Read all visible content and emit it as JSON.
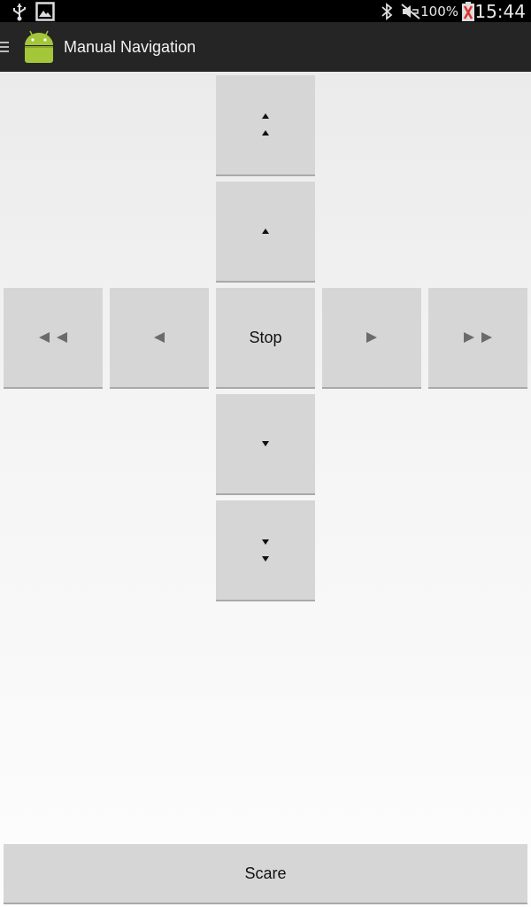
{
  "status_bar": {
    "battery_percent": "100%",
    "time": "15:44",
    "icons": [
      "usb-icon",
      "gallery-icon",
      "bluetooth-icon",
      "mute-icon",
      "battery-icon"
    ]
  },
  "action_bar": {
    "title": "Manual Navigation",
    "icons": [
      "drawer-icon",
      "android-app-icon"
    ]
  },
  "controls": {
    "forward_fast": {
      "icon": "double-up-arrow-icon"
    },
    "forward": {
      "icon": "up-arrow-icon"
    },
    "left_fast": {
      "icon": "double-left-arrow-icon"
    },
    "left": {
      "icon": "left-arrow-icon"
    },
    "stop_label": "Stop",
    "right": {
      "icon": "right-arrow-icon"
    },
    "right_fast": {
      "icon": "double-right-arrow-icon"
    },
    "backward": {
      "icon": "down-arrow-icon"
    },
    "backward_fast": {
      "icon": "double-down-arrow-icon"
    }
  },
  "scare_label": "Scare",
  "colors": {
    "button_bg": "#d6d6d6",
    "action_bar_bg": "#252525",
    "status_bar_bg": "#000000",
    "android_green": "#a4c639"
  }
}
